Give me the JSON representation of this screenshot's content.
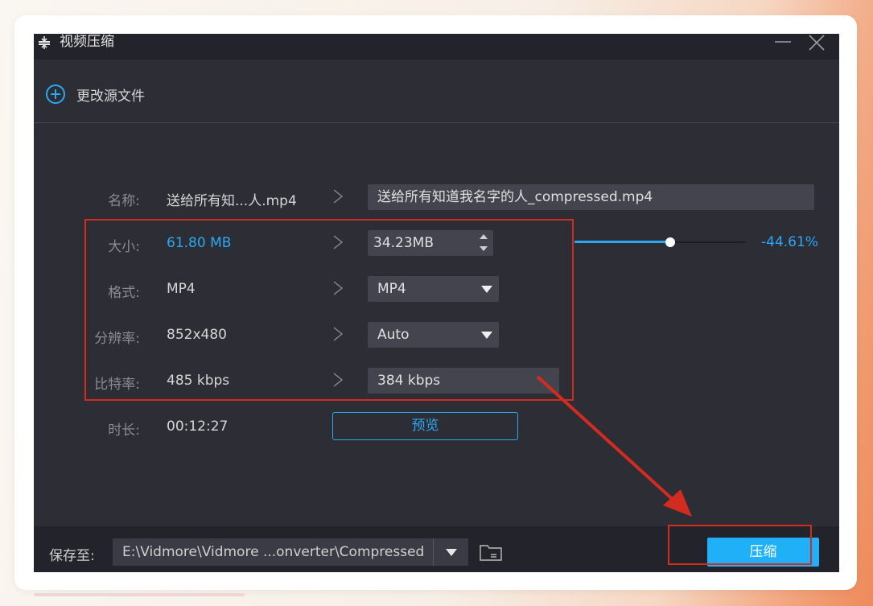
{
  "window": {
    "title": "视频压缩",
    "icons": {
      "app": "compress-icon",
      "minimize": "minimize-icon",
      "close": "close-icon"
    }
  },
  "toolbar": {
    "change_source_label": "更改源文件",
    "icon": "plus-circle-icon"
  },
  "rows": {
    "name": {
      "label": "名称:",
      "source": "送给所有知...人.mp4",
      "target": "送给所有知道我名字的人_compressed.mp4"
    },
    "size": {
      "label": "大小:",
      "source": "61.80 MB",
      "target": "34.23MB"
    },
    "format": {
      "label": "格式:",
      "source": "MP4",
      "target": "MP4"
    },
    "resolution": {
      "label": "分辨率:",
      "source": "852x480",
      "target": "Auto"
    },
    "bitrate": {
      "label": "比特率:",
      "source": "485 kbps",
      "target": "384 kbps"
    },
    "duration": {
      "label": "时长:",
      "source": "00:12:27"
    }
  },
  "slider": {
    "value_fraction": 0.56,
    "percent_text": "-44.61%"
  },
  "preview_button": "预览",
  "bottom": {
    "save_to_label": "保存至:",
    "path": "E:\\Vidmore\\Vidmore ...onverter\\Compressed",
    "compress_button": "压缩",
    "folder_icon": "folder-icon"
  },
  "colors": {
    "accent": "#2aa9f2",
    "window_bg": "#2c2d35",
    "annotation_red": "#d22b20"
  }
}
